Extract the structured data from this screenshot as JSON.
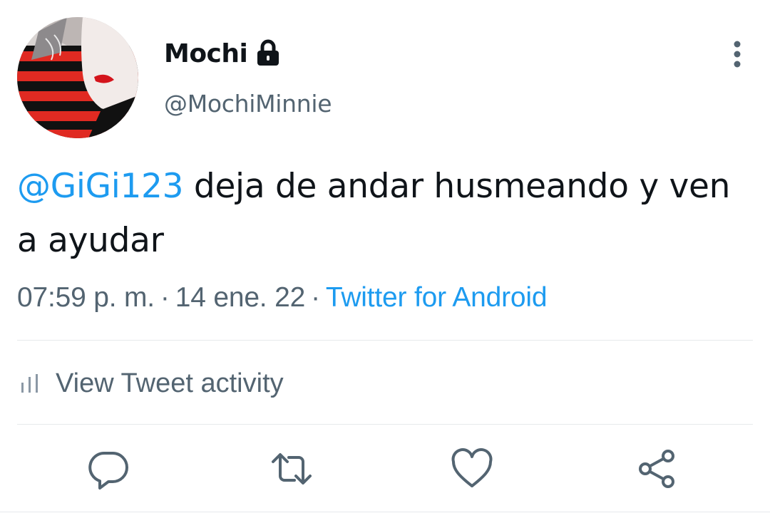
{
  "user": {
    "display_name": "Mochi",
    "handle": "@MochiMinnie",
    "protected_icon": "lock-icon",
    "avatar": "profile-avatar"
  },
  "tweet": {
    "mention": "@GiGi123",
    "text": " deja de andar husmeando y ven a ayudar",
    "time": "07:59 p. m.",
    "separator": "·",
    "date": "14 ene. 22",
    "source": "Twitter for Android"
  },
  "activity": {
    "icon": "bar-chart-icon",
    "label": "View Tweet activity"
  },
  "actions": {
    "reply_icon": "reply-icon",
    "retweet_icon": "retweet-icon",
    "like_icon": "heart-icon",
    "share_icon": "share-icon",
    "more_icon": "more-vertical-icon"
  },
  "colors": {
    "link": "#1d9bf0",
    "text": "#0f1419",
    "secondary": "#536471",
    "divider": "#e6e9ec"
  }
}
